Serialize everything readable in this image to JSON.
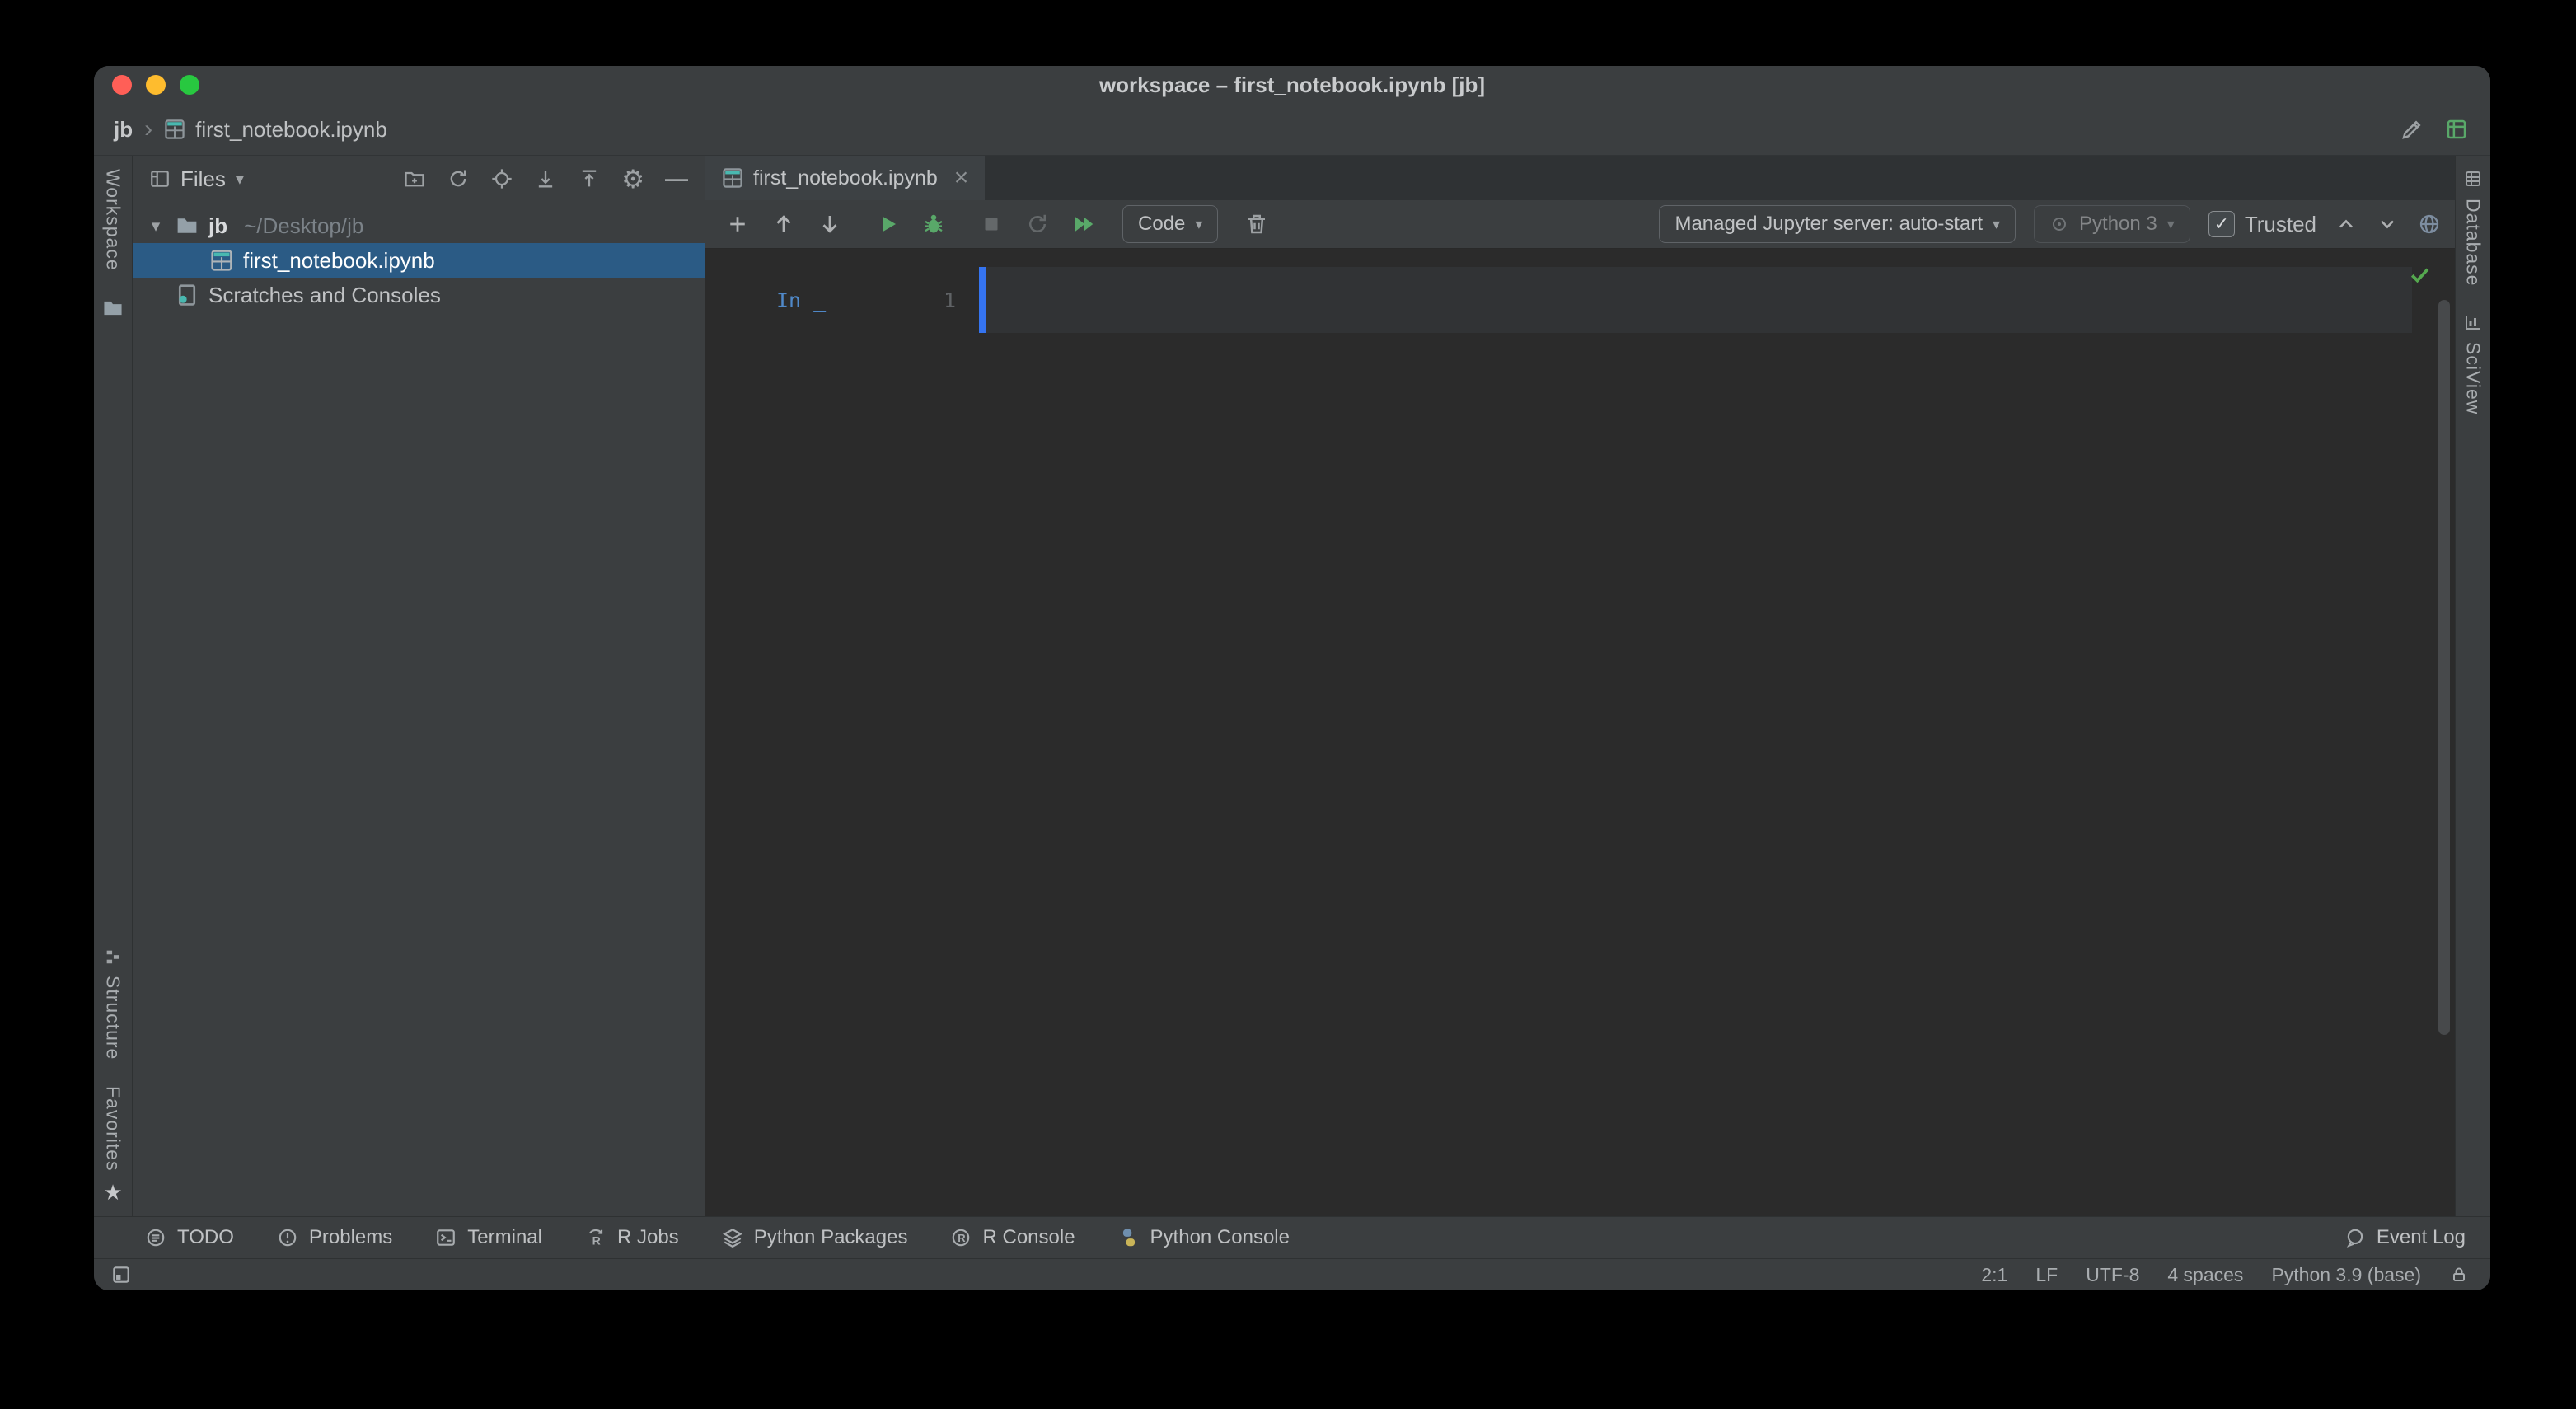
{
  "window": {
    "title": "workspace – first_notebook.ipynb [jb]"
  },
  "breadcrumbs": {
    "root": "jb",
    "file": "first_notebook.ipynb"
  },
  "left_stripe": {
    "workspace": "Workspace",
    "structure": "Structure",
    "favorites": "Favorites"
  },
  "right_stripe": {
    "database": "Database",
    "sciview": "SciView"
  },
  "project": {
    "header": {
      "title": "Files"
    },
    "tree": [
      {
        "name": "jb",
        "path": "~/Desktop/jb"
      },
      {
        "name": "first_notebook.ipynb"
      },
      {
        "name": "Scratches and Consoles"
      }
    ]
  },
  "editor": {
    "tab": {
      "label": "first_notebook.ipynb"
    },
    "toolbar": {
      "cell_type": "Code",
      "server": "Managed Jupyter server: auto-start",
      "kernel": "Python 3",
      "trusted_label": "Trusted"
    },
    "cell": {
      "prompt": "In _",
      "line_number": "1"
    }
  },
  "bottom_bar": {
    "items": [
      {
        "icon": "todo-icon",
        "label": "TODO"
      },
      {
        "icon": "problems-icon",
        "label": "Problems"
      },
      {
        "icon": "terminal-icon",
        "label": "Terminal"
      },
      {
        "icon": "r-jobs-icon",
        "label": "R Jobs"
      },
      {
        "icon": "python-packages-icon",
        "label": "Python Packages"
      },
      {
        "icon": "r-console-icon",
        "label": "R Console"
      },
      {
        "icon": "python-console-icon",
        "label": "Python Console"
      }
    ],
    "event_log": {
      "icon": "event-log-icon",
      "label": "Event Log"
    }
  },
  "status_bar": {
    "caret_position": "2:1",
    "line_separator": "LF",
    "encoding": "UTF-8",
    "indent": "4 spaces",
    "interpreter": "Python 3.9 (base)"
  },
  "glyphs": {
    "breadcrumb_separator": "›",
    "caret_down": "▾",
    "tree_expanded": "▾",
    "close": "×",
    "star": "★",
    "gear": "⚙",
    "hide": "—",
    "check": "✓"
  },
  "colors": {
    "accent_blue": "#3574f0",
    "selection_blue": "#2b5b85",
    "run_green": "#59a869",
    "check_green": "#55a84f",
    "prompt_blue": "#5089c9",
    "traffic_red": "#ff5f57",
    "traffic_yellow": "#febc2e",
    "traffic_green": "#28c840"
  }
}
